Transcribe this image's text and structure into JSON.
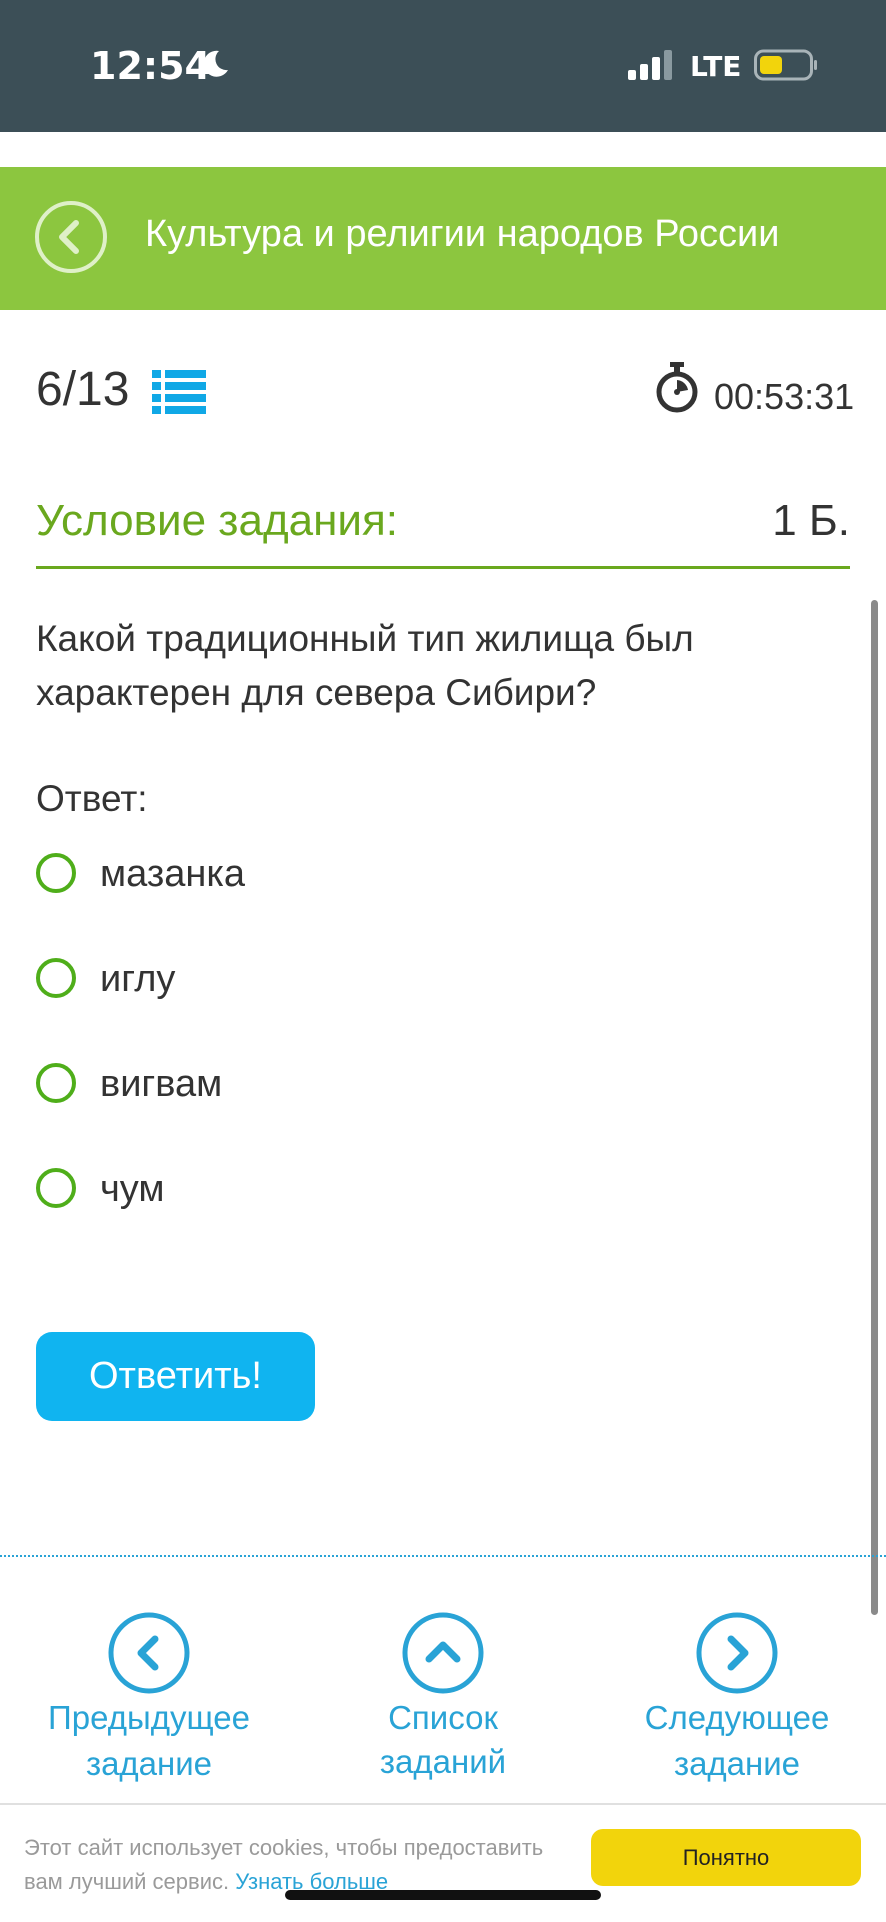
{
  "status_bar": {
    "time": "12:54",
    "network": "LTE",
    "icons": [
      "moon-icon",
      "signal-icon",
      "battery-icon"
    ]
  },
  "header": {
    "title": "Культура и религии народов России",
    "back_icon": "chevron-left-icon"
  },
  "task": {
    "progress": "6/13",
    "timer": "00:53:31",
    "condition_title": "Условие задания:",
    "points": "1 Б.",
    "question": "Какой традиционный тип жилища был характерен для севера Сибири?",
    "answer_label": "Ответ:",
    "options": [
      "мазанка",
      "иглу",
      "вигвам",
      "чум"
    ],
    "submit_label": "Ответить!"
  },
  "nav": {
    "prev_line1": "Предыдущее",
    "prev_line2": "задание",
    "list": "Список заданий",
    "next_line1": "Следующее",
    "next_line2": "задание"
  },
  "cookie": {
    "text": "Этот сайт использует cookies, чтобы предоставить вам лучший сервис.",
    "link": "Узнать больше",
    "button": "Понятно"
  },
  "colors": {
    "status_bar": "#3c4f57",
    "header": "#8cc63f",
    "accent_green": "#6aa81e",
    "accent_blue": "#29a3d6",
    "submit_blue": "#10b4f0",
    "cookie_button": "#f2d40c"
  }
}
